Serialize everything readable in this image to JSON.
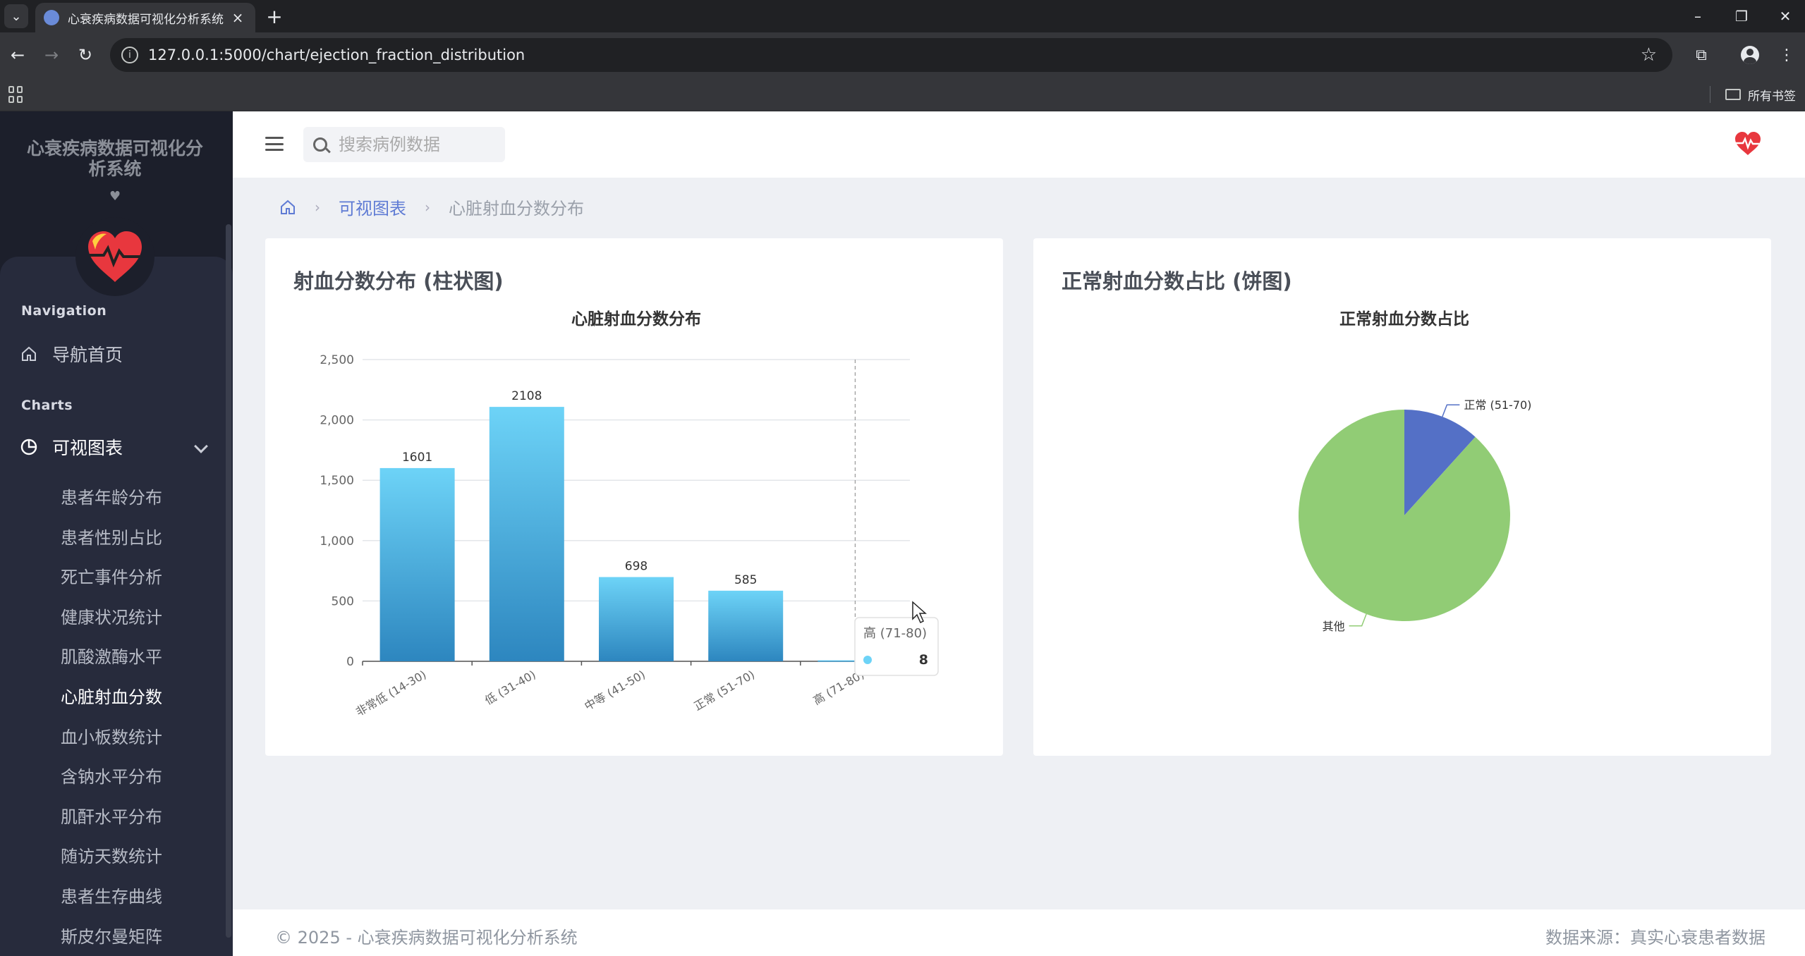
{
  "browser": {
    "tab_title": "心衰疾病数据可视化分析系统",
    "url": "127.0.0.1:5000/chart/ejection_fraction_distribution",
    "bookmarks_all": "所有书签"
  },
  "sidebar": {
    "brand": "心衰疾病数据可视化分析系统",
    "section_navigation": "Navigation",
    "home_label": "导航首页",
    "section_charts": "Charts",
    "charts_label": "可视图表",
    "items": [
      {
        "label": "患者年龄分布"
      },
      {
        "label": "患者性别占比"
      },
      {
        "label": "死亡事件分析"
      },
      {
        "label": "健康状况统计"
      },
      {
        "label": "肌酸激酶水平"
      },
      {
        "label": "心脏射血分数"
      },
      {
        "label": "血小板数统计"
      },
      {
        "label": "含钠水平分布"
      },
      {
        "label": "肌酐水平分布"
      },
      {
        "label": "随访天数统计"
      },
      {
        "label": "患者生存曲线"
      },
      {
        "label": "斯皮尔曼矩阵"
      }
    ],
    "active_index": 5
  },
  "topbar": {
    "search_placeholder": "搜索病例数据"
  },
  "breadcrumb": {
    "link": "可视图表",
    "current": "心脏射血分数分布"
  },
  "cards": {
    "bar_title": "射血分数分布 (柱状图)",
    "pie_title": "正常射血分数占比 (饼图)"
  },
  "tooltip": {
    "title": "高 (71-80)",
    "value": "8"
  },
  "colors": {
    "bar_top": "#6dd3f7",
    "bar_bottom": "#2d86bf",
    "pie_normal": "#5470c6",
    "pie_other": "#91cc75"
  },
  "chart_data": [
    {
      "type": "bar",
      "title": "心脏射血分数分布",
      "categories": [
        "非常低 (14-30)",
        "低 (31-40)",
        "中等 (41-50)",
        "正常 (51-70)",
        "高 (71-80)"
      ],
      "values": [
        1601,
        2108,
        698,
        585,
        8
      ],
      "data_labels": [
        "1601",
        "2108",
        "698",
        "585",
        "8"
      ],
      "ylim": [
        0,
        2500
      ],
      "yticks": [
        0,
        500,
        1000,
        1500,
        2000,
        2500
      ],
      "ytick_labels": [
        "0",
        "500",
        "1,000",
        "1,500",
        "2,000",
        "2,500"
      ],
      "grid": true
    },
    {
      "type": "pie",
      "title": "正常射血分数占比",
      "labels": [
        "正常 (51-70)",
        "其他"
      ],
      "values": [
        585,
        4415
      ]
    }
  ],
  "footer": {
    "left": "© 2025 - 心衰疾病数据可视化分析系统",
    "right": "数据来源：真实心衰患者数据"
  }
}
